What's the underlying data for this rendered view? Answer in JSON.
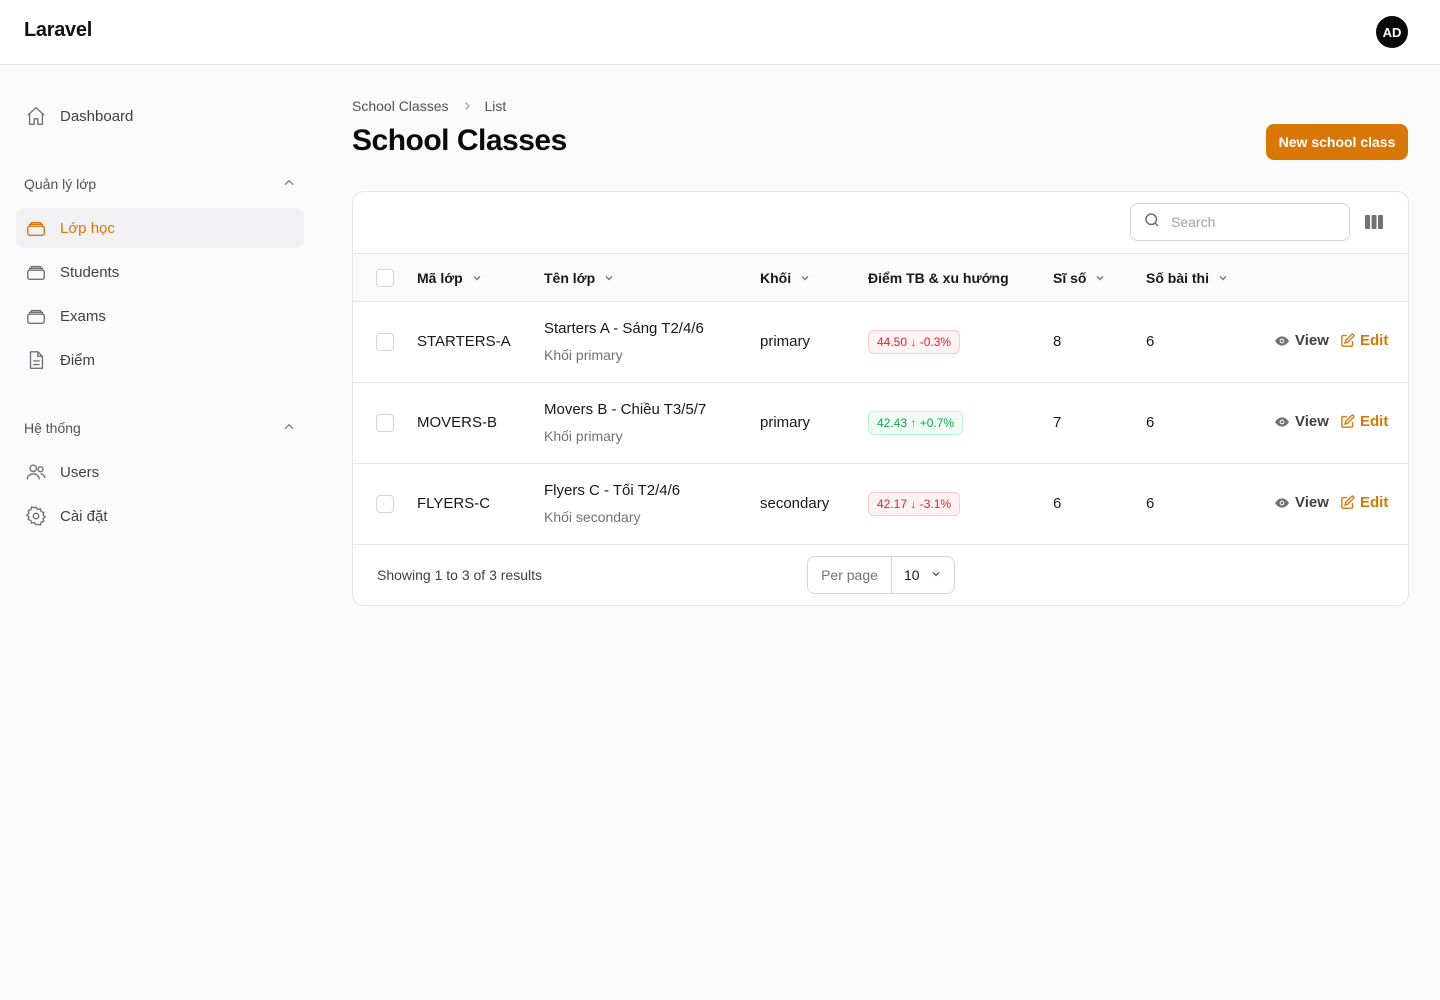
{
  "app": {
    "brand": "Laravel",
    "user_initials": "AD"
  },
  "sidebar": {
    "dashboard": "Dashboard",
    "group1_label": "Quản lý lớp",
    "group1_items": [
      "Lớp học",
      "Students",
      "Exams",
      "Điểm"
    ],
    "group2_label": "Hệ thống",
    "group2_items": [
      "Users",
      "Cài đặt"
    ]
  },
  "breadcrumb": {
    "parent": "School Classes",
    "current": "List"
  },
  "page": {
    "title": "School Classes",
    "new_button": "New school class"
  },
  "table": {
    "search_placeholder": "Search",
    "columns": [
      "Mã lớp",
      "Tên lớp",
      "Khối",
      "Điểm TB & xu hướng",
      "Sĩ số",
      "Số bài thi"
    ],
    "rows": [
      {
        "code": "STARTERS-A",
        "name": "Starters A - Sáng T2/4/6",
        "name_sub": "Khối primary",
        "level": "primary",
        "score": "44.50 ↓ -0.3%",
        "students": "8",
        "exams": "6",
        "view": "View",
        "edit": "Edit"
      },
      {
        "code": "MOVERS-B",
        "name": "Movers B - Chiều T3/5/7",
        "name_sub": "Khối primary",
        "level": "primary",
        "score": "42.43 ↑ +0.7%",
        "students": "7",
        "exams": "6",
        "view": "View",
        "edit": "Edit"
      },
      {
        "code": "FLYERS-C",
        "name": "Flyers C - Tối T2/4/6",
        "name_sub": "Khối secondary",
        "level": "secondary",
        "score": "42.17 ↓ -3.1%",
        "students": "6",
        "exams": "6",
        "view": "View",
        "edit": "Edit"
      }
    ],
    "footer": "Showing 1 to 3 of 3 results",
    "per_page_label": "Per page",
    "per_page_value": "10"
  },
  "colors": {
    "accent": "#d97706",
    "trend_down": "#dc2626",
    "trend_up": "#16a34a"
  },
  "icons": [
    "home-icon",
    "chevron-up-icon",
    "rectangle-stack-icon",
    "document-icon",
    "users-icon",
    "cog-icon",
    "search-icon",
    "columns-icon",
    "chevron-down-icon",
    "eye-icon",
    "pencil-square-icon",
    "chevron-right-icon"
  ]
}
